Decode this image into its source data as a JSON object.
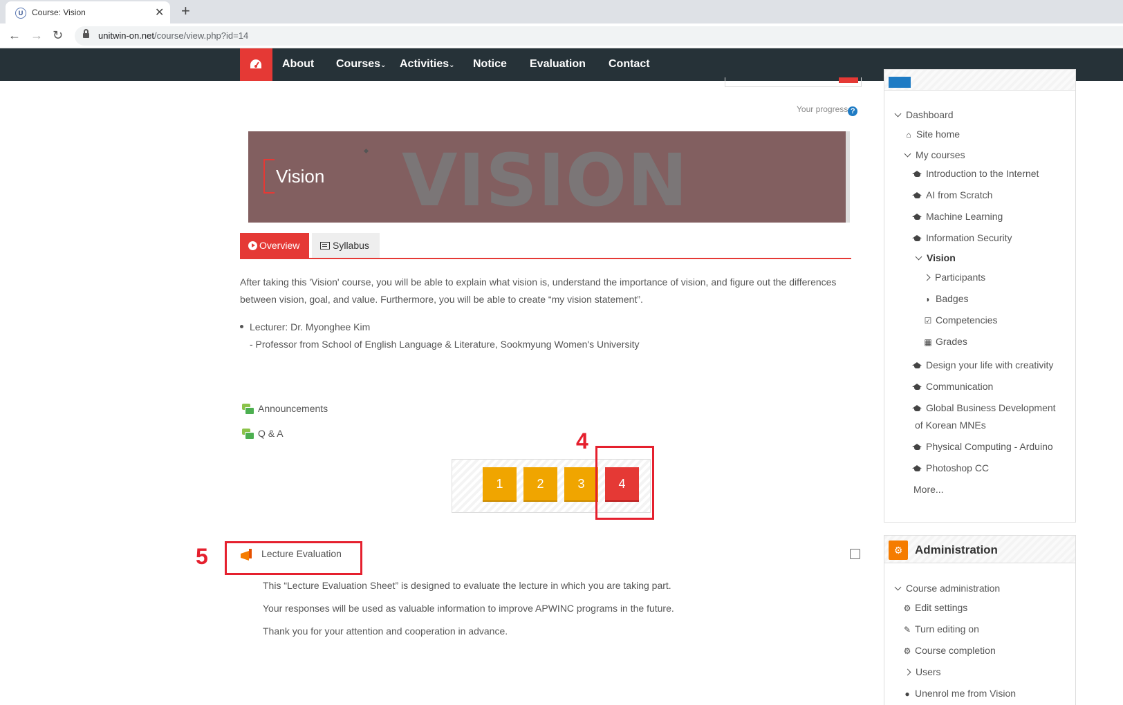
{
  "browser": {
    "tab_title": "Course: Vision",
    "url_host": "unitwin-on.net",
    "url_path": "/course/view.php?id=14"
  },
  "sitenav": {
    "items": [
      "About",
      "Courses",
      "Activities",
      "Notice",
      "Evaluation",
      "Contact"
    ]
  },
  "course": {
    "progress_label": "Your progress",
    "banner_word": "VISION",
    "banner_title": "Vision",
    "tabs": [
      "Overview",
      "Syllabus"
    ],
    "description": "After taking this 'Vision' course, you will be able to explain what vision is, understand the importance of vision, and figure out the differences between vision, goal, and value. Furthermore, you will be able to create “my vision statement”.",
    "lecturer": "Lecturer: Dr. Myonghee Kim",
    "lecturer_sub": "- Professor from School of English Language & Literature, Sookmyung Women's University",
    "forums": [
      "Announcements",
      "Q & A"
    ],
    "pages": [
      "1",
      "2",
      "3",
      "4"
    ],
    "active_page": "4",
    "lecture_evaluation": "Lecture Evaluation",
    "eval_lines": [
      "This “Lecture Evaluation Sheet” is designed to evaluate the lecture in which you are taking part.",
      "Your responses will be used as valuable information to improve APWINC programs in the future.",
      "Thank you for your attention and cooperation in advance."
    ]
  },
  "callouts": {
    "pager_number": "4",
    "eval_number": "5"
  },
  "navigation": {
    "dashboard": "Dashboard",
    "site_home": "Site home",
    "my_courses": "My courses",
    "courses": [
      "Introduction to the Internet",
      "AI from Scratch",
      "Machine Learning",
      "Information Security"
    ],
    "current_course": "Vision",
    "course_children": [
      "Participants",
      "Badges",
      "Competencies",
      "Grades"
    ],
    "more_courses": [
      "Design your life with creativity",
      "Communication",
      "Global Business Development",
      "of Korean MNEs",
      "Physical Computing - Arduino",
      "Photoshop CC"
    ],
    "more": "More..."
  },
  "administration": {
    "title": "Administration",
    "course_admin": "Course administration",
    "items": [
      "Edit settings",
      "Turn editing on",
      "Course completion",
      "Users",
      "Unenrol me from Vision"
    ]
  },
  "colors": {
    "accent": "#e53935",
    "nav_bg": "#263238",
    "pager_yellow": "#f0a500",
    "callout_red": "#e5202e"
  }
}
